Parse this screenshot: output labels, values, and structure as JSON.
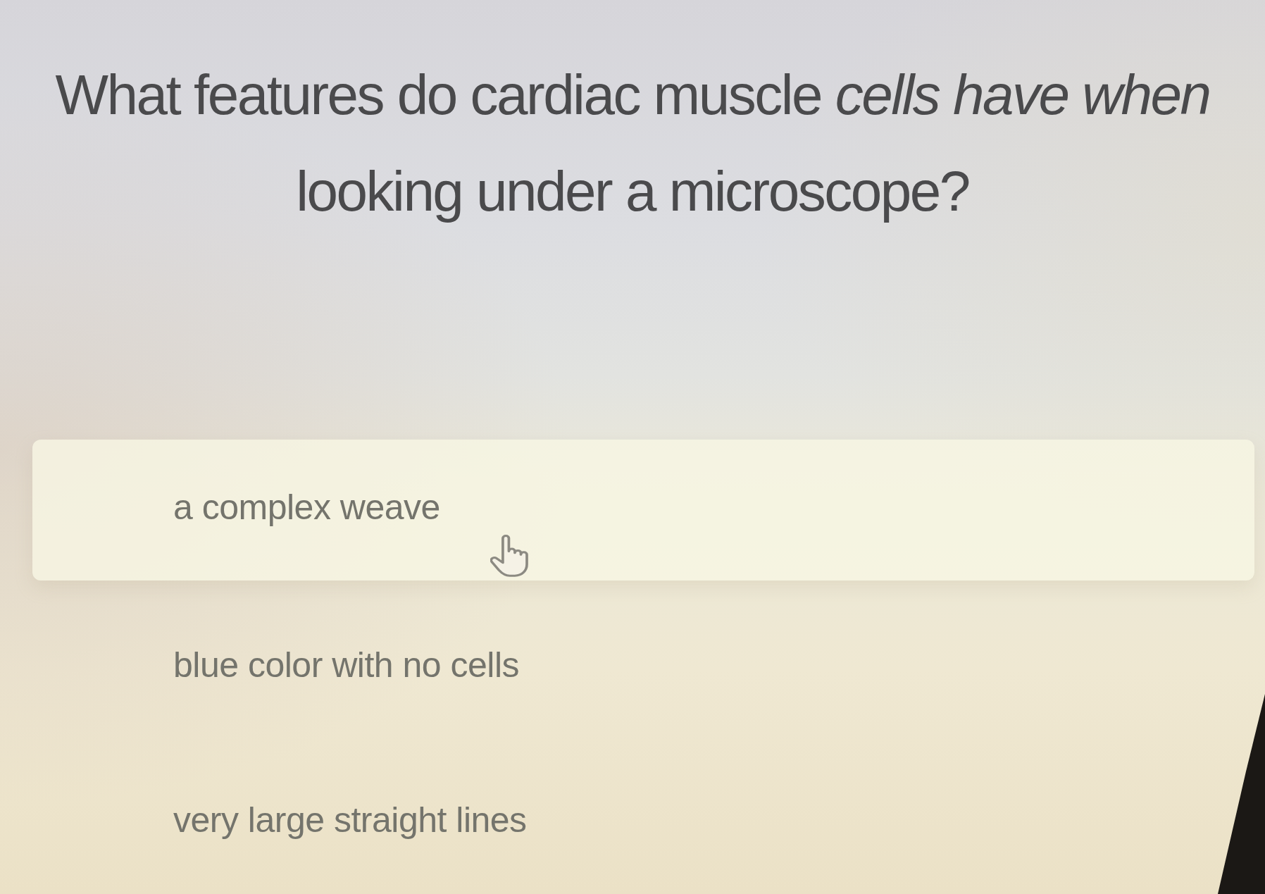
{
  "question": {
    "text": "What features do cardiac muscle *cells have when* looking under a microscope?"
  },
  "options": [
    {
      "label": "a complex weave",
      "hovered": true
    },
    {
      "label": "blue color with no cells",
      "hovered": false
    },
    {
      "label": "very large straight lines",
      "hovered": false
    }
  ]
}
